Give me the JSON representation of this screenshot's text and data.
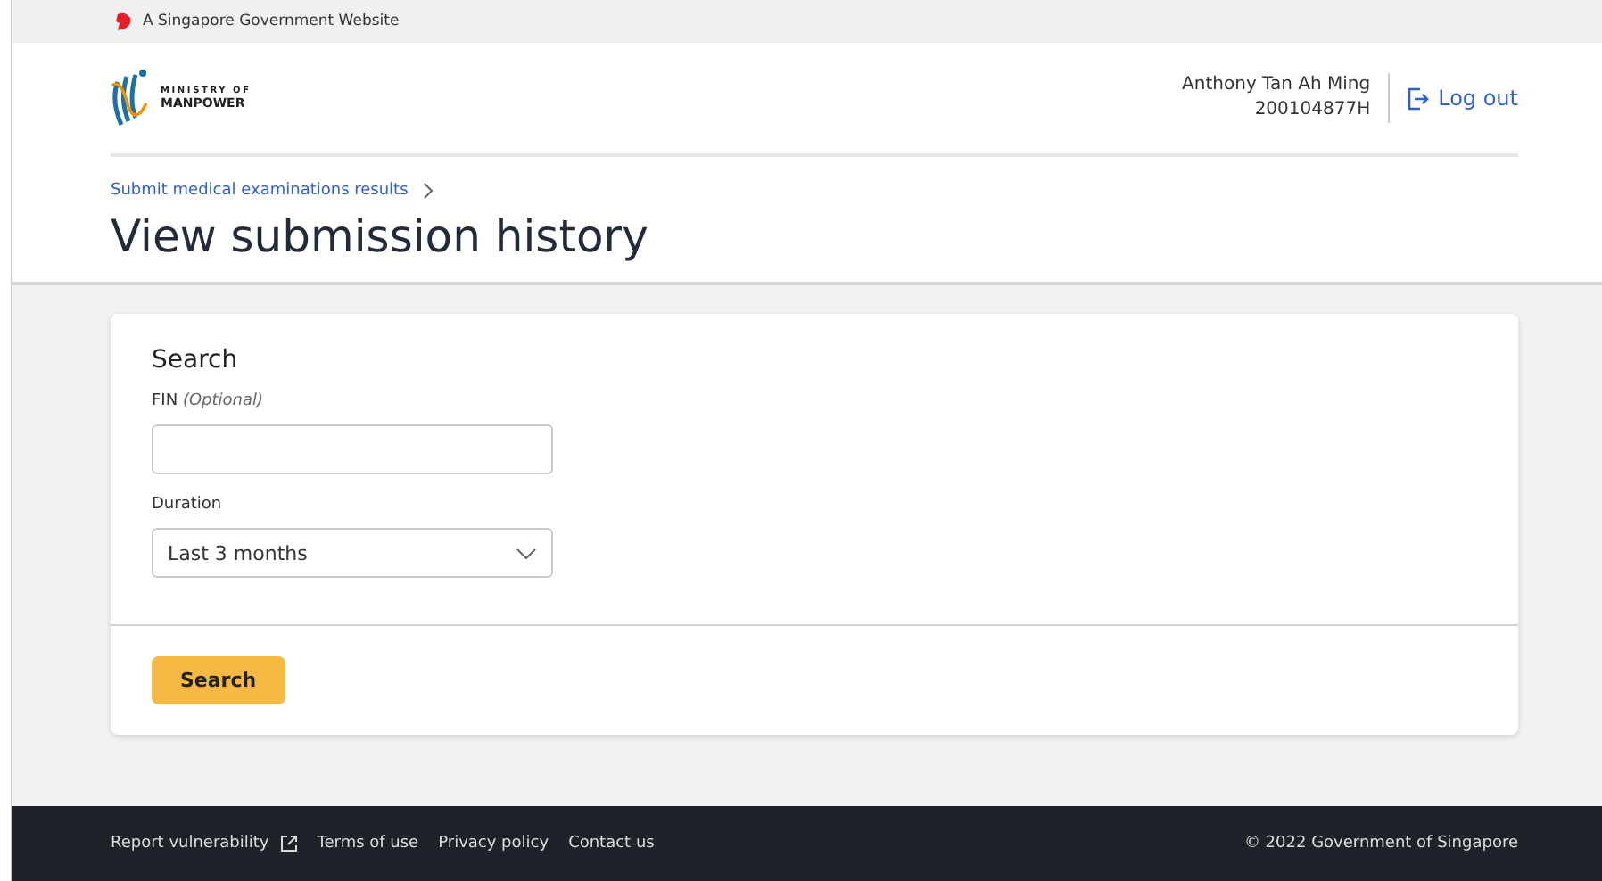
{
  "masthead": {
    "text": "A Singapore Government Website"
  },
  "header": {
    "logo": {
      "line_1": "MINISTRY OF",
      "line_2": "MANPOWER"
    },
    "user": {
      "name": "Anthony Tan Ah Ming",
      "id": "200104877H"
    },
    "logout": "Log out"
  },
  "breadcrumb": [
    "Submit medical examinations results"
  ],
  "page_title": "View submission history",
  "search_card": {
    "title": "Search",
    "fields": [
      {
        "kind": "text",
        "label": "FIN",
        "hint": "(Optional)"
      },
      {
        "kind": "select",
        "label": "Duration",
        "value": "Last 3 months"
      }
    ],
    "button": "Search"
  },
  "footer": {
    "links": [
      {
        "label": "Report vulnerability",
        "external": true
      },
      {
        "label": "Terms of use",
        "external": false
      },
      {
        "label": "Privacy policy",
        "external": false
      },
      {
        "label": "Contact us",
        "external": false
      }
    ],
    "copyright": "© 2022 Government of Singapore"
  }
}
